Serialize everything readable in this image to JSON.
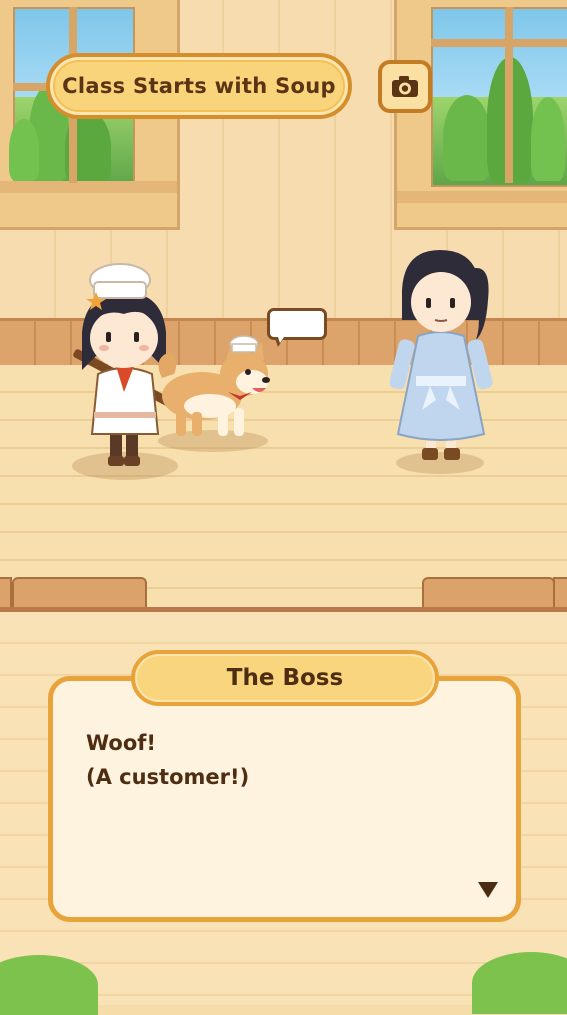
{
  "scene": {
    "title": "Class Starts with Soup",
    "camera_icon": "camera-icon"
  },
  "dialogue": {
    "speaker": "The Boss",
    "lines": [
      "Woof!",
      "(A customer!)"
    ],
    "next_icon": "triangle-down-icon"
  },
  "colors": {
    "accent_orange": "#e8a33a",
    "text_brown": "#4e2d12",
    "pill_yellow": "#f9d47a"
  }
}
